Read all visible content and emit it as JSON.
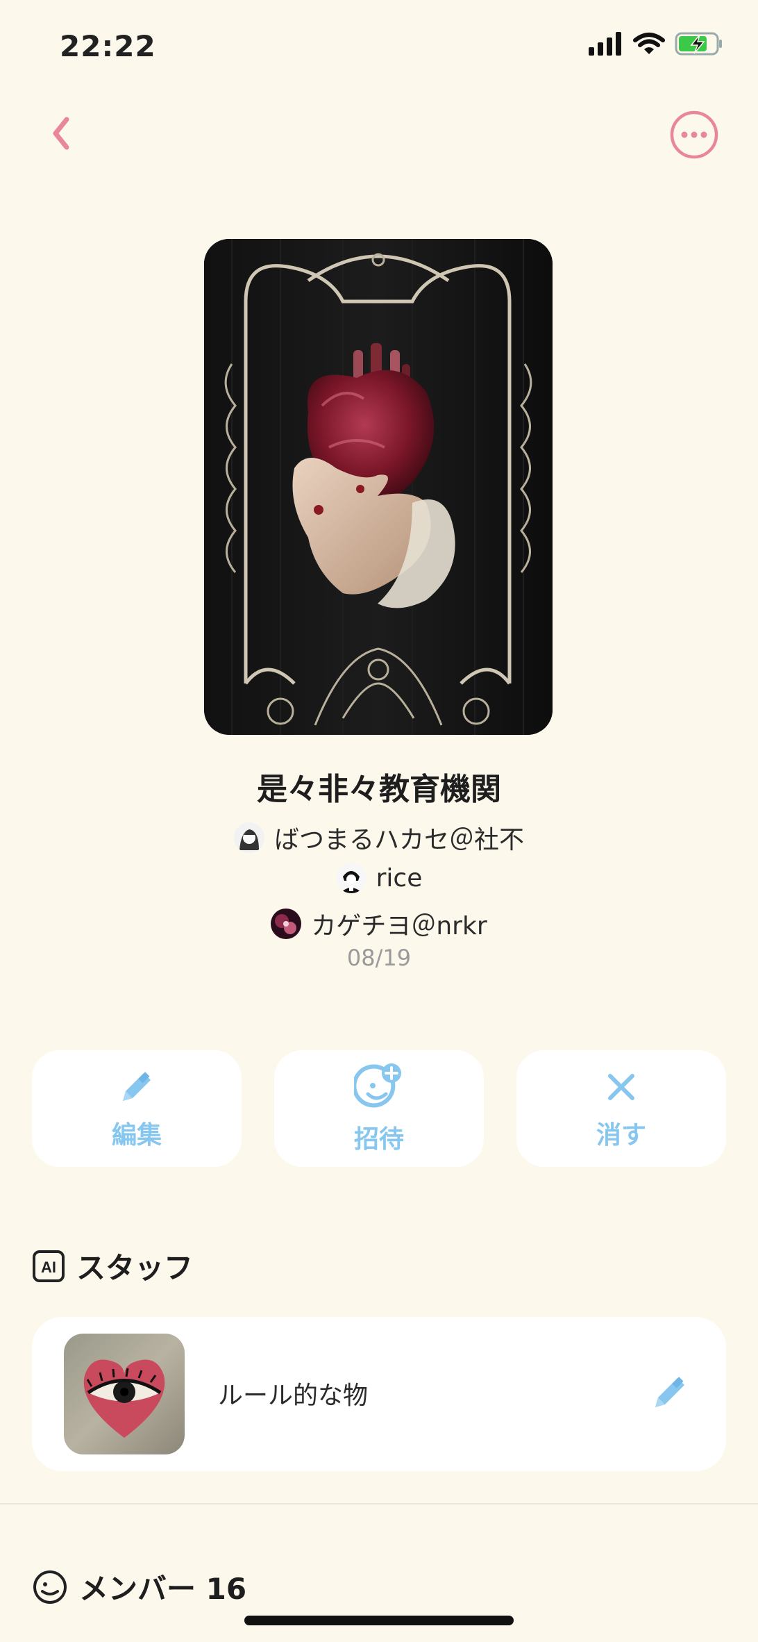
{
  "status_bar": {
    "time": "22:22"
  },
  "nav": {
    "back_icon": "chevron-left-icon",
    "more_icon": "ellipsis-circle-icon",
    "accent": "#e8869a"
  },
  "room": {
    "title": "是々非々教育機関",
    "authors": [
      {
        "name": "ばつまるハカセ＠社不"
      },
      {
        "name": "rice"
      },
      {
        "name": "カゲチヨ＠nrkr"
      }
    ],
    "date": "08/19"
  },
  "actions": [
    {
      "label": "編集",
      "icon": "pencil-icon"
    },
    {
      "label": "招待",
      "icon": "add-friend-icon"
    },
    {
      "label": "消す",
      "icon": "close-icon"
    }
  ],
  "action_color": "#86c6ef",
  "staff_section": {
    "icon": "ai-icon",
    "title": "スタッフ",
    "item": {
      "name": "ルール的な物",
      "edit_icon": "pencil-icon"
    }
  },
  "members_section": {
    "icon": "smile-icon",
    "title": "メンバー 16"
  }
}
